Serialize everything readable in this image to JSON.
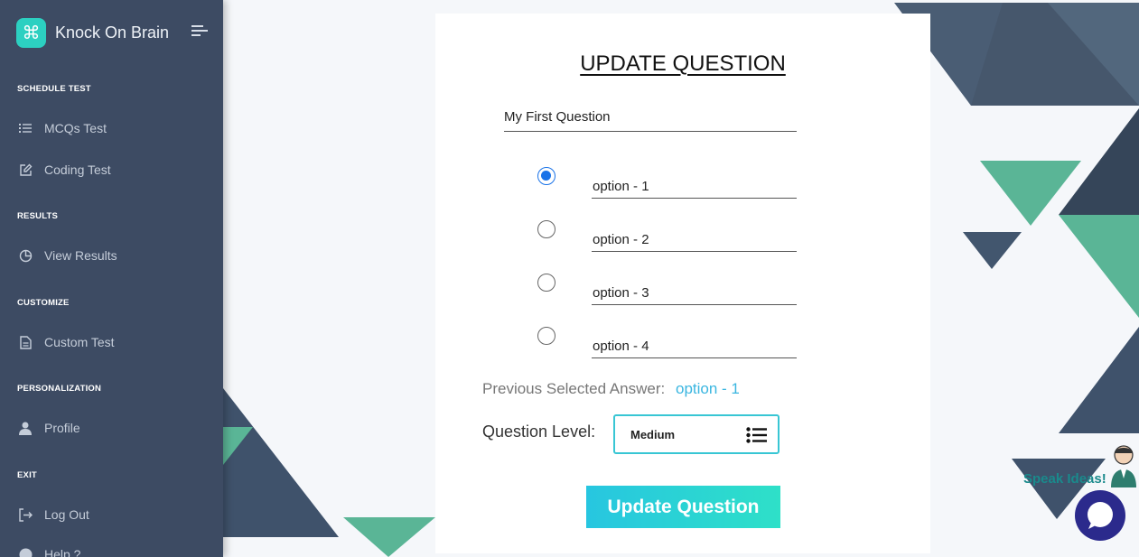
{
  "sidebar": {
    "brand": "Knock On Brain",
    "logo_glyph": "⌘",
    "sections": {
      "schedule": "SCHEDULE TEST",
      "results": "RESULTS",
      "customize": "CUSTOMIZE",
      "personalization": "PERSONALIZATION",
      "exit": "EXIT"
    },
    "items": {
      "mcqs": "MCQs Test",
      "coding": "Coding Test",
      "view_results": "View Results",
      "custom": "Custom Test",
      "profile": "Profile",
      "logout": "Log Out",
      "help": "Help ?"
    }
  },
  "form": {
    "title": "UPDATE QUESTION",
    "question": "My First Question",
    "options": [
      "option - 1",
      "option - 2",
      "option - 3",
      "option - 4"
    ],
    "selected_option_index": 0,
    "previous_label": "Previous Selected Answer:",
    "previous_value": "option - 1",
    "level_label": "Question Level:",
    "level_value": "Medium",
    "submit_label": "Update Question"
  },
  "chat": {
    "label": "Speak Ideas!"
  },
  "colors": {
    "sidebar": "#3d4b63",
    "accent": "#2cd0c1",
    "radio": "#1a73e8",
    "chat": "#2b2a8c"
  }
}
